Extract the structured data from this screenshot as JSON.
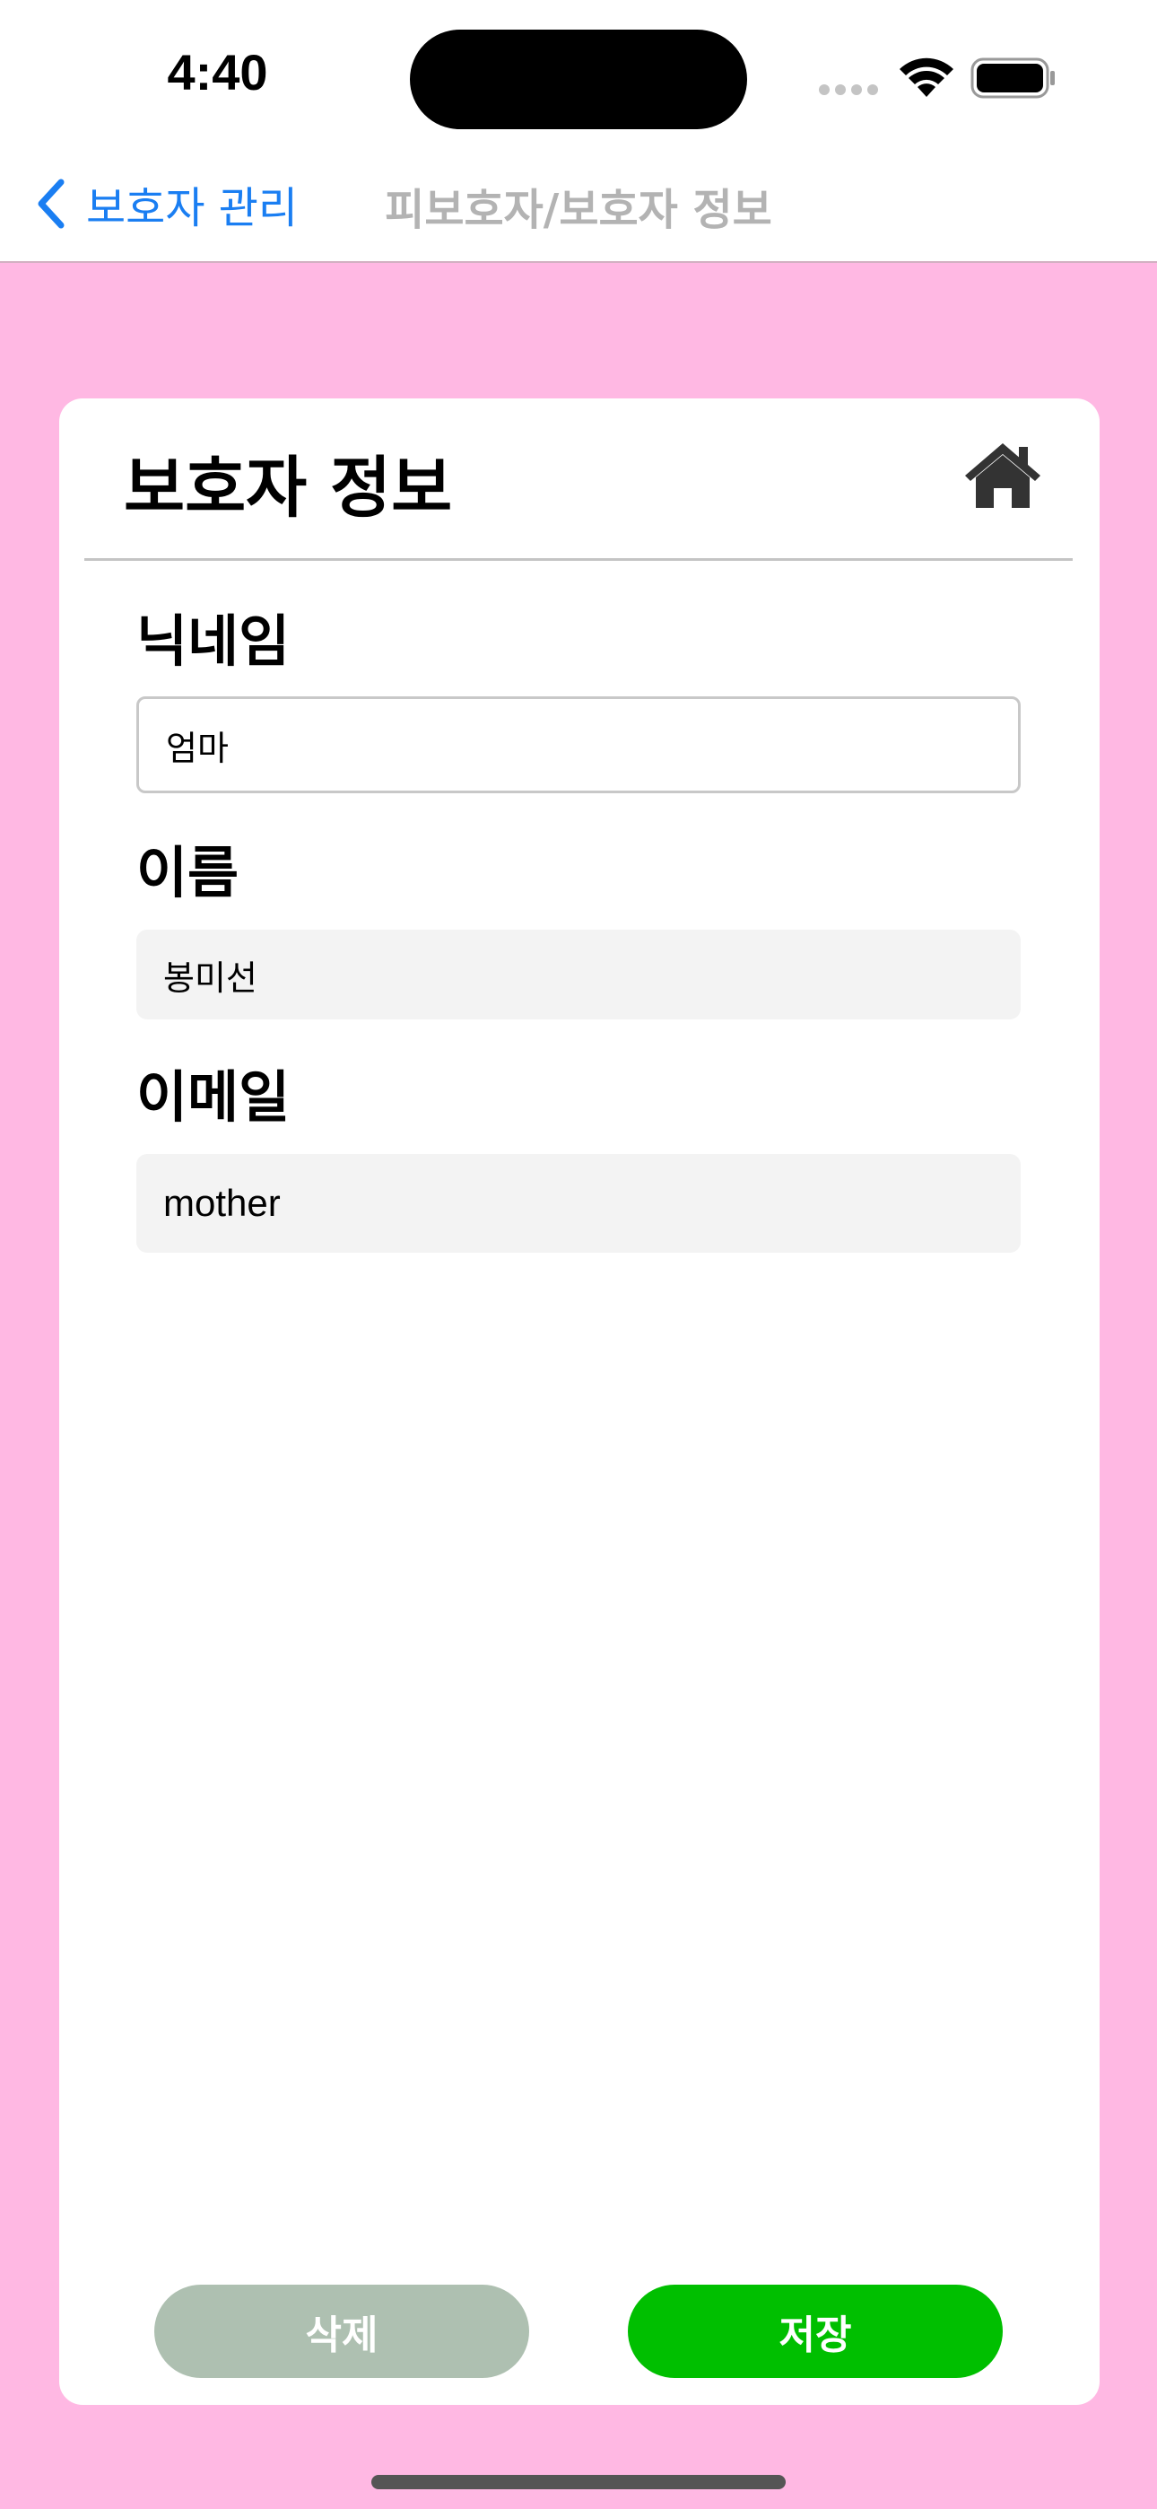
{
  "status_bar": {
    "time": "4:40"
  },
  "nav": {
    "back_label": "보호자 관리",
    "title": "피보호자/보호자 정보"
  },
  "card": {
    "title": "보호자 정보",
    "home_icon": "home-icon"
  },
  "form": {
    "nickname_label": "닉네임",
    "nickname_value": "엄마",
    "name_label": "이름",
    "name_value": "봉미선",
    "email_label": "이메일",
    "email_value": "mother"
  },
  "actions": {
    "delete_label": "삭제",
    "save_label": "저장"
  },
  "colors": {
    "background": "#ffb8e3",
    "accent_blue": "#1a7ef2",
    "save_green": "#00bf00",
    "delete_gray_green": "#aec0b1"
  }
}
